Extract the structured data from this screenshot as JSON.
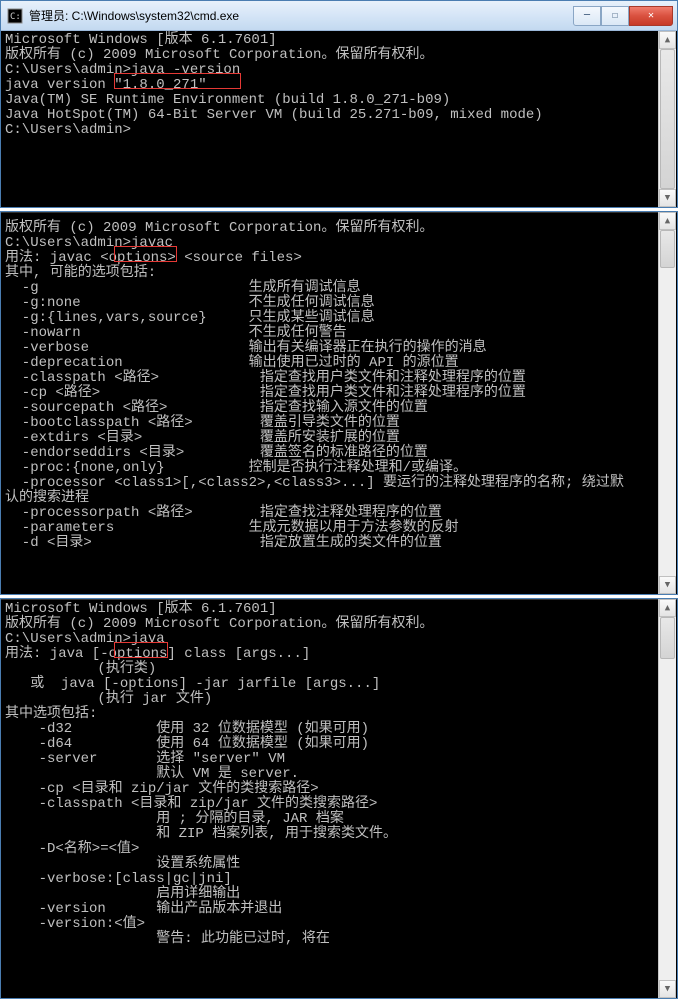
{
  "window1": {
    "title": "管理员: C:\\Windows\\system32\\cmd.exe",
    "lines": [
      "Microsoft Windows [版本 6.1.7601]",
      "版权所有 (c) 2009 Microsoft Corporation。保留所有权利。",
      "",
      "C:\\Users\\admin>java -version",
      "java version \"1.8.0_271\"",
      "Java(TM) SE Runtime Environment (build 1.8.0_271-b09)",
      "Java HotSpot(TM) 64-Bit Server VM (build 25.271-b09, mixed mode)",
      "",
      "C:\\Users\\admin>",
      ""
    ],
    "highlight_cmd": "java -version"
  },
  "window2": {
    "lines": [
      "版权所有 (c) 2009 Microsoft Corporation。保留所有权利。",
      "",
      "C:\\Users\\admin>javac",
      "用法: javac <options> <source files>",
      "其中, 可能的选项包括:",
      "  -g                         生成所有调试信息",
      "  -g:none                    不生成任何调试信息",
      "  -g:{lines,vars,source}     只生成某些调试信息",
      "  -nowarn                    不生成任何警告",
      "  -verbose                   输出有关编译器正在执行的操作的消息",
      "  -deprecation               输出使用已过时的 API 的源位置",
      "  -classpath <路径>            指定查找用户类文件和注释处理程序的位置",
      "  -cp <路径>                   指定查找用户类文件和注释处理程序的位置",
      "  -sourcepath <路径>           指定查找输入源文件的位置",
      "  -bootclasspath <路径>        覆盖引导类文件的位置",
      "  -extdirs <目录>              覆盖所安装扩展的位置",
      "  -endorseddirs <目录>         覆盖签名的标准路径的位置",
      "  -proc:{none,only}          控制是否执行注释处理和/或编译。",
      "  -processor <class1>[,<class2>,<class3>...] 要运行的注释处理程序的名称; 绕过默",
      "认的搜索进程",
      "  -processorpath <路径>        指定查找注释处理程序的位置",
      "  -parameters                生成元数据以用于方法参数的反射",
      "  -d <目录>                    指定放置生成的类文件的位置"
    ],
    "highlight_cmd": "javac"
  },
  "window3": {
    "lines": [
      "Microsoft Windows [版本 6.1.7601]",
      "版权所有 (c) 2009 Microsoft Corporation。保留所有权利。",
      "",
      "C:\\Users\\admin>java",
      "用法: java [-options] class [args...]",
      "           (执行类)",
      "   或  java [-options] -jar jarfile [args...]",
      "           (执行 jar 文件)",
      "其中选项包括:",
      "    -d32          使用 32 位数据模型 (如果可用)",
      "    -d64          使用 64 位数据模型 (如果可用)",
      "    -server       选择 \"server\" VM",
      "                  默认 VM 是 server.",
      "",
      "    -cp <目录和 zip/jar 文件的类搜索路径>",
      "    -classpath <目录和 zip/jar 文件的类搜索路径>",
      "                  用 ; 分隔的目录, JAR 档案",
      "                  和 ZIP 档案列表, 用于搜索类文件。",
      "    -D<名称>=<值>",
      "                  设置系统属性",
      "    -verbose:[class|gc|jni]",
      "                  启用详细输出",
      "    -version      输出产品版本并退出",
      "    -version:<值>",
      "                  警告: 此功能已过时, 将在"
    ],
    "highlight_cmd": "java"
  }
}
